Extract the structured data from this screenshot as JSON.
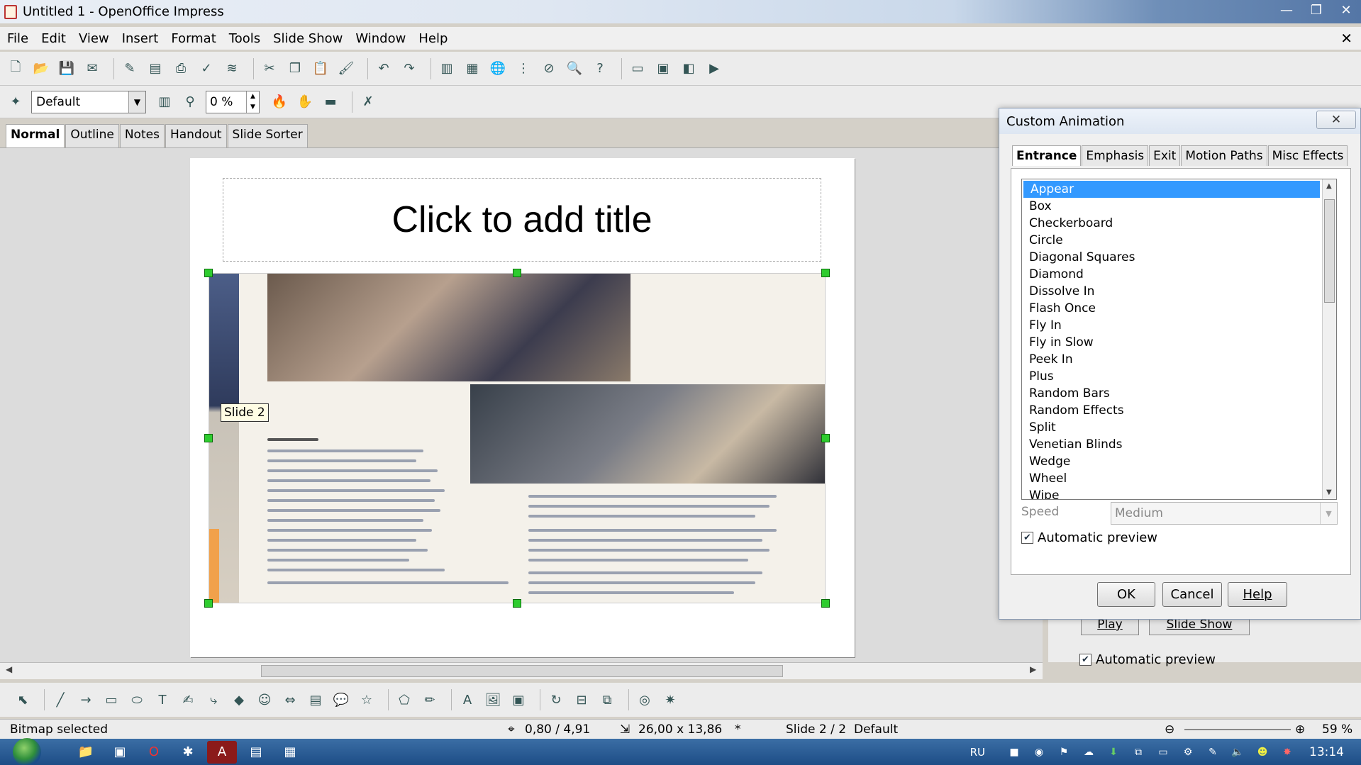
{
  "window": {
    "title": "Untitled 1 - OpenOffice Impress",
    "minimize": "—",
    "maximize": "❐",
    "close": "✕"
  },
  "menu": {
    "items": [
      "File",
      "Edit",
      "View",
      "Insert",
      "Format",
      "Tools",
      "Slide Show",
      "Window",
      "Help"
    ],
    "doc_close": "✕"
  },
  "toolbar2": {
    "style_value": "Default",
    "transparency_value": "0 %"
  },
  "view_tabs": [
    "Normal",
    "Outline",
    "Notes",
    "Handout",
    "Slide Sorter"
  ],
  "slide": {
    "title_placeholder": "Click to add title",
    "tooltip": "Slide 2"
  },
  "behind_pane": {
    "play_label": "Play",
    "slideshow_label": "Slide Show",
    "automatic_preview": "Automatic preview"
  },
  "status": {
    "message": "Bitmap selected",
    "position": "0,80 / 4,91",
    "size": "26,00 x 13,86",
    "modified": "*",
    "slide_counter": "Slide 2 / 2",
    "layout": "Default",
    "zoom": "59 %"
  },
  "taskbar": {
    "language": "RU",
    "clock": "13:14"
  },
  "dialog": {
    "title": "Custom Animation",
    "close": "✕",
    "tabs": [
      "Entrance",
      "Emphasis",
      "Exit",
      "Motion Paths",
      "Misc Effects"
    ],
    "active_tab": "Entrance",
    "effects": [
      "Appear",
      "Box",
      "Checkerboard",
      "Circle",
      "Diagonal Squares",
      "Diamond",
      "Dissolve In",
      "Flash Once",
      "Fly In",
      "Fly in Slow",
      "Peek In",
      "Plus",
      "Random Bars",
      "Random Effects",
      "Split",
      "Venetian Blinds",
      "Wedge",
      "Wheel",
      "Wipe"
    ],
    "selected_effect": "Appear",
    "speed_label": "Speed",
    "speed_value": "Medium",
    "automatic_preview": "Automatic preview",
    "ok": "OK",
    "cancel": "Cancel",
    "help": "Help"
  },
  "icons": {
    "toolbar1": [
      "new-icon",
      "open-icon",
      "save-icon",
      "email-icon",
      "edit-file-icon",
      "export-pdf-icon",
      "print-icon",
      "spellcheck-icon",
      "autospell-icon",
      "cut-icon",
      "copy-icon",
      "paste-icon",
      "format-paintbrush-icon",
      "undo-icon",
      "redo-icon",
      "chart-icon",
      "table-icon",
      "hyperlink-icon",
      "grid-icon",
      "navigator-icon",
      "zoom-icon",
      "help-icon",
      "slide-icon",
      "slide-layout-icon",
      "slide-design-icon",
      "presentation-icon"
    ],
    "drawing": [
      "select-icon",
      "line-icon",
      "arrow-line-icon",
      "rectangle-icon",
      "ellipse-icon",
      "text-icon",
      "curve-icon",
      "connector-icon",
      "basic-shapes-icon",
      "symbol-shapes-icon",
      "block-arrows-icon",
      "flowchart-icon",
      "callouts-icon",
      "stars-icon",
      "points-icon",
      "glue-icon",
      "fontwork-icon",
      "from-file-icon",
      "gallery-icon",
      "rotate-icon",
      "align-icon",
      "arrange-icon",
      "extrusion-icon",
      "effects-icon"
    ]
  }
}
